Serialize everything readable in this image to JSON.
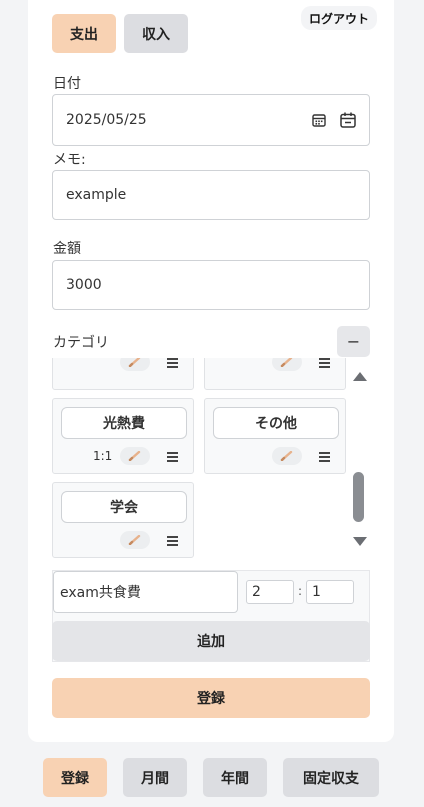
{
  "header": {
    "type_tabs": [
      {
        "label": "支出",
        "active": true
      },
      {
        "label": "収入",
        "active": false
      }
    ],
    "logout_label": "ログアウト"
  },
  "form": {
    "date": {
      "label": "日付",
      "value": "2025/05/25"
    },
    "memo": {
      "label": "メモ:",
      "value": "example"
    },
    "amount": {
      "label": "金額",
      "value": "3000"
    },
    "category": {
      "label": "カテゴリ",
      "collapse_symbol": "−"
    }
  },
  "categories": [
    {
      "name": "光熱費",
      "ratio": "1:1"
    },
    {
      "name": "その他",
      "ratio": ""
    },
    {
      "name": "学会",
      "ratio": ""
    }
  ],
  "add_category": {
    "name_value": "exam共食費",
    "ratio_left": "2",
    "ratio_sep": ":",
    "ratio_right": "1",
    "add_label": "追加"
  },
  "submit_label": "登録",
  "bottom_nav": [
    {
      "label": "登録",
      "active": true
    },
    {
      "label": "月間",
      "active": false
    },
    {
      "label": "年間",
      "active": false
    },
    {
      "label": "固定収支",
      "active": false
    }
  ],
  "colors": {
    "accent": "#f8d2b3",
    "inactive": "#dcdde1",
    "background": "#f3f4f6"
  }
}
